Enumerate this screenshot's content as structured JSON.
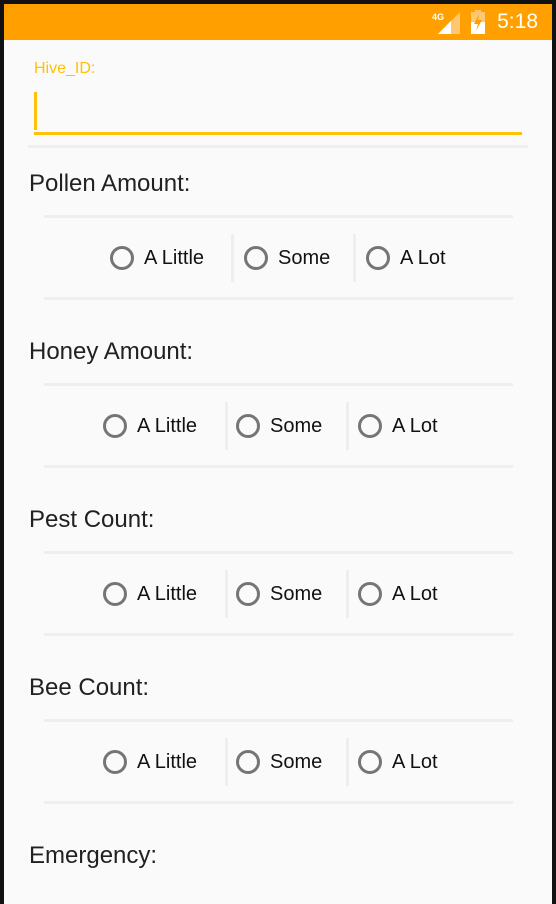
{
  "status_bar": {
    "network": "4G",
    "time": "5:18",
    "color": "#FFA000"
  },
  "hive_id": {
    "label": "Hive_ID:",
    "value": ""
  },
  "questions": [
    {
      "label": "Pollen Amount:",
      "options": [
        "A Little",
        "Some",
        "A Lot"
      ]
    },
    {
      "label": "Honey Amount:",
      "options": [
        "A Little",
        "Some",
        "A Lot"
      ]
    },
    {
      "label": "Pest Count:",
      "options": [
        "A Little",
        "Some",
        "A Lot"
      ]
    },
    {
      "label": "Bee Count:",
      "options": [
        "A Little",
        "Some",
        "A Lot"
      ]
    },
    {
      "label": "Emergency:"
    }
  ],
  "accent": "#FFC107"
}
